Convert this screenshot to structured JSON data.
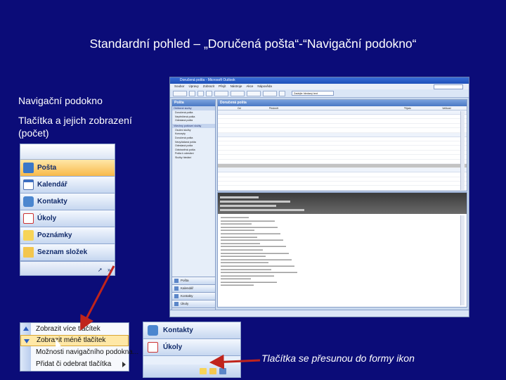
{
  "slide": {
    "title": "Standardní pohled – „Doručená pošta“-“Navigační podokno“",
    "caption_nav": "Navigační podokno",
    "caption_buttons": "Tlačítka a jejich zobrazení (počet)",
    "caption_icons": "Tlačítka se přesunou do formy ikon"
  },
  "nav_pane": {
    "buttons": [
      {
        "label": "Pošta",
        "icon": "mail-icon",
        "active": true
      },
      {
        "label": "Kalendář",
        "icon": "calendar-icon"
      },
      {
        "label": "Kontakty",
        "icon": "contacts-icon"
      },
      {
        "label": "Úkoly",
        "icon": "tasks-icon"
      },
      {
        "label": "Poznámky",
        "icon": "notes-icon"
      },
      {
        "label": "Seznam složek",
        "icon": "folder-list-icon"
      }
    ],
    "footer_icons": [
      "shortcut-icon",
      "configure-buttons-icon"
    ]
  },
  "context_menu": {
    "items": [
      {
        "label": "Zobrazit více tlačítek",
        "icon": "arrow-up-icon"
      },
      {
        "label": "Zobrazit méně tlačítek",
        "icon": "arrow-down-icon",
        "highlighted": true
      },
      {
        "label": "Možnosti navigačního podokna..."
      },
      {
        "label": "Přidat či odebrat tlačítka",
        "submenu": true
      }
    ]
  },
  "collapsed_pane": {
    "buttons": [
      {
        "label": "Kontakty",
        "icon": "contacts-icon"
      },
      {
        "label": "Úkoly",
        "icon": "tasks-icon"
      }
    ],
    "mini_icons": [
      "notes-icon",
      "folder-list-icon",
      "shortcut-icon"
    ]
  },
  "outlook": {
    "window_title": "Doručená pošta - Microsoft Outlook",
    "menu": [
      "Soubor",
      "Úpravy",
      "Zobrazit",
      "Přejít",
      "Nástroje",
      "Akce",
      "Nápověda"
    ],
    "nav_header": "Pošta",
    "list_header": "Doručená pošta",
    "search_text": "Zadejte hledaný text",
    "columns": [
      "Od",
      "Předmět",
      "Přijato",
      "Velikost"
    ],
    "nav_sections": [
      "Oblíbené složky",
      "Všechny poštovní složky"
    ],
    "nav_folders": [
      "Doručená pošta",
      "Nepřečtená pošta",
      "Odeslaná pošta",
      "Osobní složky",
      "Koncepty",
      "Doručená pošta",
      "Nevyžádaná pošta",
      "Odeslaná pošta",
      "Odstraněná pošta",
      "Pošta k odeslání",
      "Složky hledání"
    ],
    "nav_buttons": [
      "Pošta",
      "Kalendář",
      "Kontakty",
      "Úkoly"
    ]
  }
}
